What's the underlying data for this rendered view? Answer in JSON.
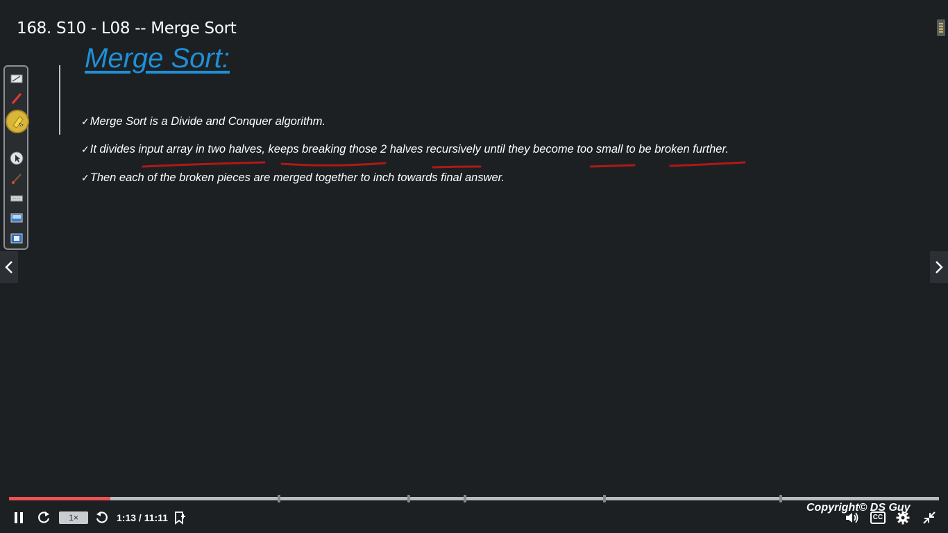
{
  "video": {
    "title": "168. S10 - L08 -- Merge Sort"
  },
  "slide": {
    "title": "Merge Sort:",
    "bullets": [
      "Merge Sort is a Divide and Conquer algorithm.",
      "It divides input array in two halves, keeps breaking those 2 halves recursively until they become too small to be broken further.",
      "Then each of the broken pieces are merged together to inch towards final answer."
    ],
    "check_glyph": "✓"
  },
  "toolbar": {
    "tools": [
      "notepad-icon",
      "pen-icon",
      "highlighter-icon",
      "pointer-icon",
      "brush-icon",
      "keyboard-icon",
      "screen-icon",
      "screenshot-icon"
    ],
    "active_tool": "highlighter-icon"
  },
  "player": {
    "progress_fraction": 0.109,
    "chapter_markers": [
      0.29,
      0.43,
      0.49,
      0.64,
      0.83
    ],
    "speed_label": "1×",
    "time": "1:13 / 11:11",
    "copyright": "Copyright© DS Guy",
    "accent_color": "#ec5252"
  }
}
